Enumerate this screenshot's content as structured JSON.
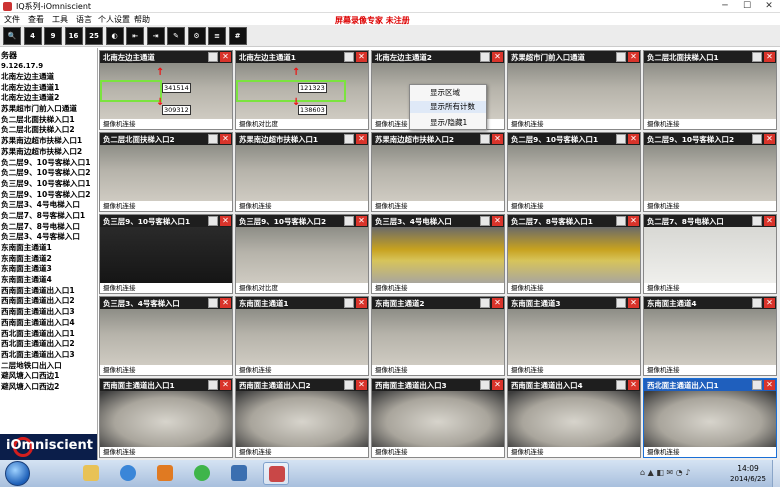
{
  "window": {
    "title": "IQ系列-iOmniscient",
    "controls": {
      "minimize": "─",
      "maximize": "☐",
      "close": "✕"
    }
  },
  "menubar": {
    "items": [
      "文件",
      "查看",
      "工具",
      "语言",
      "个人设置",
      "帮助"
    ],
    "watermark": "屏幕录像专家  未注册"
  },
  "toolbar": {
    "buttons": [
      {
        "label": "🔍",
        "icon": "search-icon"
      },
      {
        "label": "4",
        "icon": "layout-4-icon"
      },
      {
        "label": "9",
        "icon": "layout-9-icon"
      },
      {
        "label": "16",
        "icon": "layout-16-icon"
      },
      {
        "label": "25",
        "icon": "layout-25-icon"
      },
      {
        "label": "◐",
        "icon": "globe-icon"
      },
      {
        "label": "⇤",
        "icon": "prev-page-icon"
      },
      {
        "label": "⇥",
        "icon": "next-page-icon"
      },
      {
        "label": "✎",
        "icon": "edit-icon"
      },
      {
        "label": "⚙",
        "icon": "config-icon"
      },
      {
        "label": "≡",
        "icon": "list-icon"
      },
      {
        "label": "#",
        "icon": "grid-icon"
      }
    ]
  },
  "sidebar": {
    "header": "务器",
    "server_ip": "9.126.17.9",
    "items": [
      "北南左边主通道",
      "北南左边主通道1",
      "北南左边主通道2",
      "苏果超市门前入口通道",
      "负二层北面扶梯入口1",
      "负二层北面扶梯入口2",
      "苏果南边超市扶梯入口1",
      "苏果南边超市扶梯入口2",
      "负二层9、10号客梯入口1",
      "负二层9、10号客梯入口2",
      "负三层9、10号客梯入口1",
      "负三层9、10号客梯入口2",
      "负三层3、4号电梯入口",
      "负二层7、8号客梯入口1",
      "负二层7、8号电梯入口",
      "负三层3、4号客梯入口",
      "东南面主通道1",
      "东南面主通道2",
      "东南面主通道3",
      "东南面主通道4",
      "西南面主通道出入口1",
      "西南面主通道出入口2",
      "西南面主通道出入口3",
      "西南面主通道出入口4",
      "西北面主通道出入口1",
      "西北面主通道出入口2",
      "西北面主通道出入口3",
      "二层地铁口出入口",
      "避风塘入口西边1",
      "避风塘入口西边2"
    ],
    "logo_text": "iOmniscient"
  },
  "cameras": [
    {
      "title": "北南左边主通道",
      "footer": "摄像机连接",
      "style": "normal",
      "counts": [
        "341514",
        "309312"
      ]
    },
    {
      "title": "北南左边主通道1",
      "footer": "摄像机对比度",
      "style": "normal",
      "counts": [
        "121323",
        "138603"
      ]
    },
    {
      "title": "北南左边主通道2",
      "footer": "摄像机连接",
      "style": "normal"
    },
    {
      "title": "苏果超市门前入口通道",
      "footer": "摄像机连接",
      "style": "normal"
    },
    {
      "title": "负二层北面扶梯入口1",
      "footer": "摄像机连接",
      "style": "normal"
    },
    {
      "title": "负二层北面扶梯入口2",
      "footer": "摄像机连接",
      "style": "normal"
    },
    {
      "title": "苏果南边超市扶梯入口1",
      "footer": "摄像机连接",
      "style": "normal"
    },
    {
      "title": "苏果南边超市扶梯入口2",
      "footer": "摄像机连接",
      "style": "normal"
    },
    {
      "title": "负二层9、10号客梯入口1",
      "footer": "摄像机连接",
      "style": "normal"
    },
    {
      "title": "负二层9、10号客梯入口2",
      "footer": "摄像机连接",
      "style": "normal"
    },
    {
      "title": "负三层9、10号客梯入口1",
      "footer": "摄像机连接",
      "style": "dark"
    },
    {
      "title": "负三层9、10号客梯入口2",
      "footer": "摄像机对比度",
      "style": "normal"
    },
    {
      "title": "负三层3、4号电梯入口",
      "footer": "摄像机连接",
      "style": "yellow"
    },
    {
      "title": "负二层7、8号客梯入口1",
      "footer": "摄像机连接",
      "style": "yellow"
    },
    {
      "title": "负二层7、8号电梯入口",
      "footer": "摄像机连接",
      "style": "bright"
    },
    {
      "title": "负三层3、4号客梯入口",
      "footer": "摄像机连接",
      "style": "normal"
    },
    {
      "title": "东南面主通道1",
      "footer": "摄像机连接",
      "style": "normal"
    },
    {
      "title": "东南面主通道2",
      "footer": "摄像机连接",
      "style": "normal"
    },
    {
      "title": "东南面主通道3",
      "footer": "摄像机连接",
      "style": "normal"
    },
    {
      "title": "东南面主通道4",
      "footer": "摄像机连接",
      "style": "normal"
    },
    {
      "title": "西南面主通道出入口1",
      "footer": "摄像机连接",
      "style": "fisheye"
    },
    {
      "title": "西南面主通道出入口2",
      "footer": "摄像机连接",
      "style": "fisheye"
    },
    {
      "title": "西南面主通道出入口3",
      "footer": "摄像机连接",
      "style": "fisheye"
    },
    {
      "title": "西南面主通道出入口4",
      "footer": "摄像机连接",
      "style": "fisheye"
    },
    {
      "title": "西北面主通道出入口1",
      "footer": "摄像机连接",
      "style": "fisheye",
      "selected": true
    }
  ],
  "context_menu": {
    "items": [
      "显示区域",
      "显示所有计数",
      "显示/隐藏1"
    ]
  },
  "taskbar": {
    "time": "14:09",
    "date": "2014/6/25",
    "tray": "⌂ ▲ ◧ ✉ ◔ ♪"
  },
  "colors": {
    "accent": "#1f5fbd",
    "close": "#d9342b",
    "watermark": "#dd0000"
  }
}
